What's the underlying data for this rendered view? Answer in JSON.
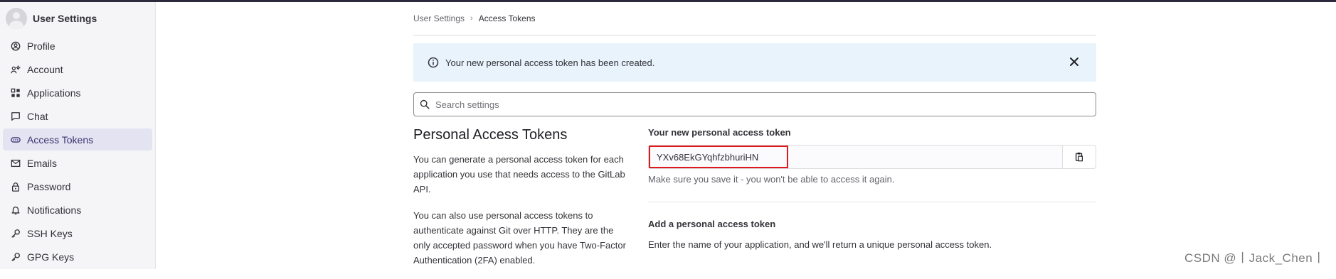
{
  "sidebar": {
    "title": "User Settings",
    "items": [
      {
        "label": "Profile",
        "icon": "profile-icon"
      },
      {
        "label": "Account",
        "icon": "account-icon"
      },
      {
        "label": "Applications",
        "icon": "applications-icon"
      },
      {
        "label": "Chat",
        "icon": "chat-icon"
      },
      {
        "label": "Access Tokens",
        "icon": "token-icon",
        "active": true
      },
      {
        "label": "Emails",
        "icon": "mail-icon"
      },
      {
        "label": "Password",
        "icon": "lock-icon"
      },
      {
        "label": "Notifications",
        "icon": "bell-icon"
      },
      {
        "label": "SSH Keys",
        "icon": "key-icon"
      },
      {
        "label": "GPG Keys",
        "icon": "key-icon"
      }
    ]
  },
  "breadcrumb": {
    "parent": "User Settings",
    "separator": "›",
    "current": "Access Tokens"
  },
  "alert": {
    "message": "Your new personal access token has been created."
  },
  "search": {
    "placeholder": "Search settings"
  },
  "section": {
    "title": "Personal Access Tokens",
    "description_1": "You can generate a personal access token for each application you use that needs access to the GitLab API.",
    "description_2": "You can also use personal access tokens to authenticate against Git over HTTP. They are the only accepted password when you have Two-Factor Authentication (2FA) enabled."
  },
  "new_token": {
    "label": "Your new personal access token",
    "value": "YXv68EkGYqhfzbhuriHN",
    "help": "Make sure you save it - you won't be able to access it again."
  },
  "add_token": {
    "title": "Add a personal access token",
    "description": "Enter the name of your application, and we'll return a unique personal access token."
  },
  "watermark": "CSDN @丨Jack_Chen丨",
  "colors": {
    "active_nav_bg": "#e4e3f1",
    "alert_bg": "#e9f3fc",
    "token_highlight": "#e0181b"
  }
}
